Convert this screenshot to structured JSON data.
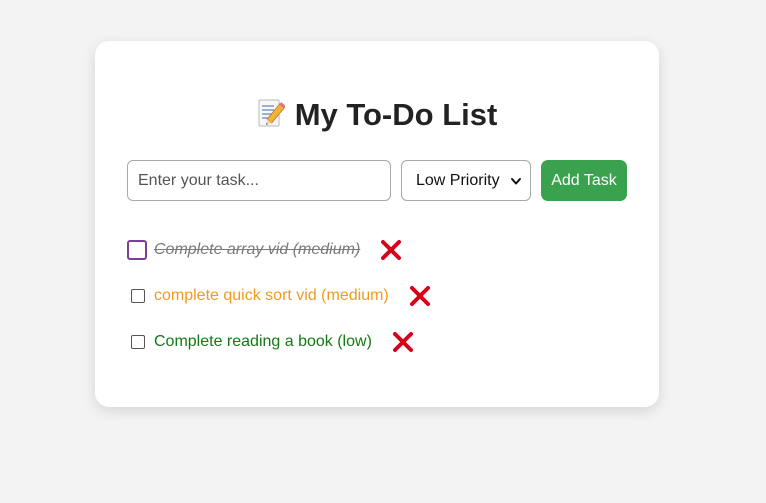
{
  "app": {
    "title": "My To-Do List",
    "title_icon": "memo-pencil-icon"
  },
  "form": {
    "task_placeholder": "Enter your task...",
    "task_value": "",
    "priority_selected": "Low Priority",
    "add_label": "Add Task"
  },
  "tasks": [
    {
      "text": "Complete array vid (medium)",
      "priority": "medium",
      "completed": true,
      "color": "#7a7a7a"
    },
    {
      "text": "complete quick sort vid (medium)",
      "priority": "medium",
      "completed": false,
      "color": "#f29a1f"
    },
    {
      "text": "Complete reading a book (low)",
      "priority": "low",
      "completed": false,
      "color": "#127a12"
    }
  ],
  "colors": {
    "accent_green": "#3aa24f",
    "checkbox_purple": "#7a3e95",
    "delete_red": "#d9001b",
    "background": "#f3f3f3"
  },
  "icons": {
    "delete": "cross-mark-icon",
    "select_arrow": "chevron-down-icon",
    "checkbox_check": "checkmark-icon"
  }
}
